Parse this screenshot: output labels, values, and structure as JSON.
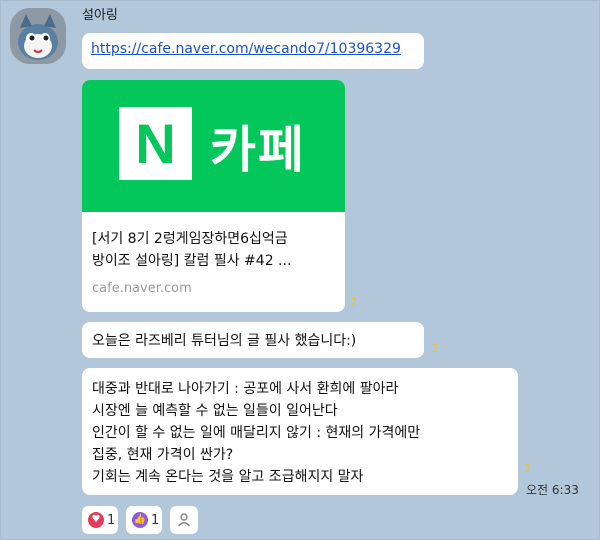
{
  "chat": {
    "sender_name": "설아링",
    "link_url": "https://cafe.naver.com/wecando7/10396329",
    "card": {
      "banner_word": "카페",
      "banner_letter": "N",
      "title_line1": "[서기 8기 2렁게임장하면6십억금",
      "title_line2": "방이조 설아링] 칼럼 필사 #42 ...",
      "domain": "cafe.naver.com",
      "unread": "2"
    },
    "message2": {
      "text": "오늘은 라즈베리 튜터님의 글 필사 했습니다:)",
      "unread": "2"
    },
    "message3": {
      "lines": [
        "대중과 반대로 나아가기 : 공포에 사서 환희에 팔아라",
        "시장엔 늘 예측할 수 없는 일들이 일어난다",
        "인간이 할 수 없는 일에 매달리지 않기 : 현재의 가격에만",
        "집중, 현재 가격이 싼가?",
        "기회는 계속 온다는 것을 알고 조급해지지 말자"
      ],
      "unread": "2",
      "time": "오전 6:33"
    },
    "reactions": [
      {
        "icon": "heart-icon",
        "count": "1",
        "color": "#e23b5b"
      },
      {
        "icon": "thumbs-up-icon",
        "count": "1",
        "color": "#8c5be0"
      },
      {
        "icon": "person-icon",
        "count": "",
        "color": "#888888"
      }
    ]
  }
}
